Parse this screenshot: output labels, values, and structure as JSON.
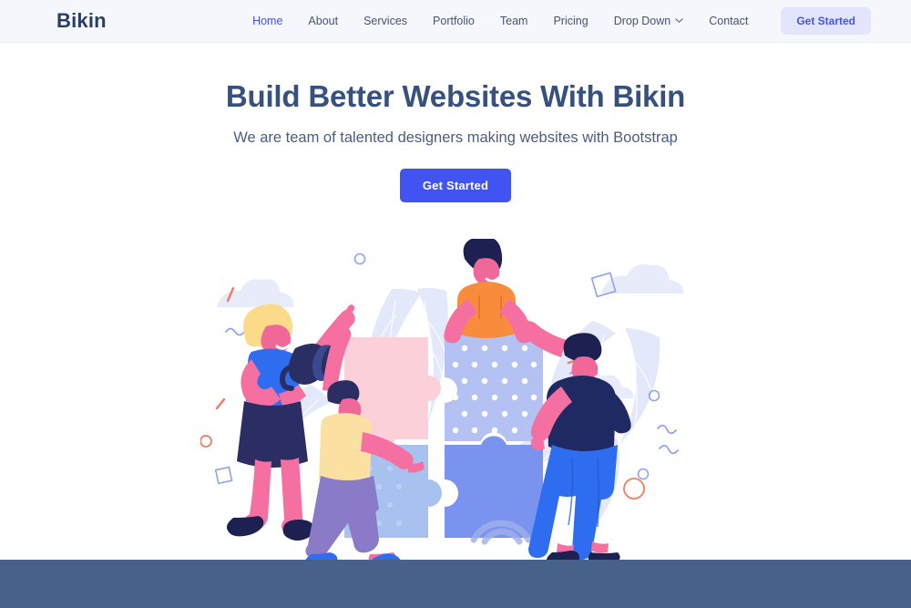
{
  "header": {
    "logo": "Bikin",
    "nav_items": [
      {
        "label": "Home",
        "active": true,
        "dropdown": false
      },
      {
        "label": "About",
        "active": false,
        "dropdown": false
      },
      {
        "label": "Services",
        "active": false,
        "dropdown": false
      },
      {
        "label": "Portfolio",
        "active": false,
        "dropdown": false
      },
      {
        "label": "Team",
        "active": false,
        "dropdown": false
      },
      {
        "label": "Pricing",
        "active": false,
        "dropdown": false
      },
      {
        "label": "Drop Down",
        "active": false,
        "dropdown": true
      },
      {
        "label": "Contact",
        "active": false,
        "dropdown": false
      }
    ],
    "cta_label": "Get Started"
  },
  "hero": {
    "title": "Build Better Websites With Bikin",
    "subtitle": "We are team of talented designers making websites with Bootstrap",
    "cta_label": "Get Started",
    "illustration_alt": "team-assembling-puzzle-illustration"
  },
  "colors": {
    "header_bg": "#f6f7fc",
    "accent_blue": "#4154f1",
    "nav_cta_bg": "#e2e5fb",
    "heading_navy": "#37517e",
    "subtitle": "#4a5e82",
    "bottom_band": "#47618b",
    "illus_pink": "#f56fa1",
    "illus_pink_light": "#fbd0d9",
    "illus_periwinkle": "#b3c2f2",
    "illus_blue": "#7a93ee",
    "illus_blue_light": "#a8c2f0",
    "illus_navy": "#2b2e63",
    "illus_orange": "#f98c3c",
    "illus_cream": "#fbe0a2",
    "illus_purple": "#8b7ac7",
    "illus_bright_blue": "#2f6df0",
    "illus_leaf": "#e4e9fb"
  }
}
